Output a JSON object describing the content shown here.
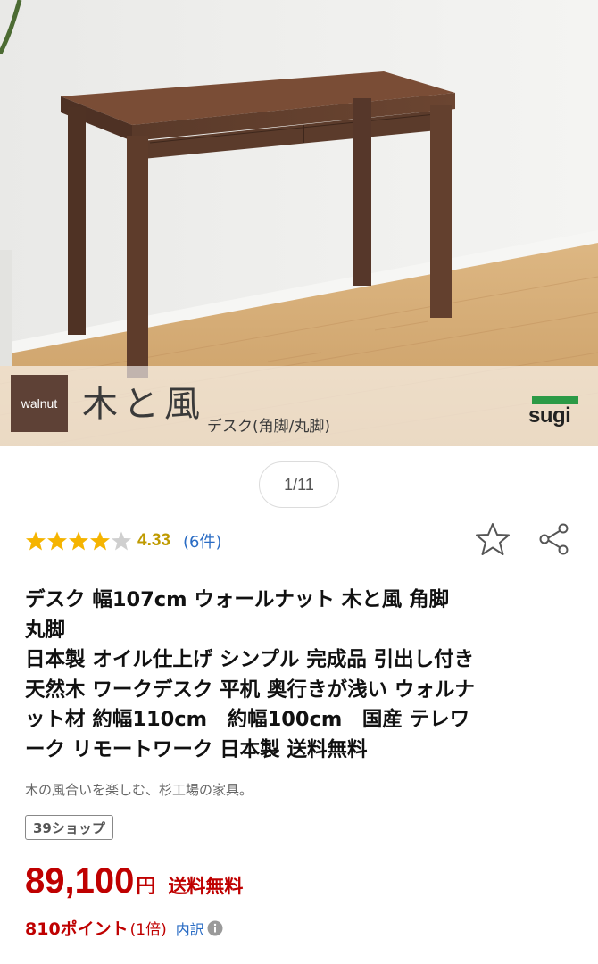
{
  "image": {
    "tag": "walnut",
    "brand_title": "木と風",
    "brand_subtitle": "デスク(角脚/丸脚)",
    "logo_text": "sugi"
  },
  "gallery": {
    "counter": "1/11"
  },
  "rating": {
    "value": "4.33",
    "count": "(6件)",
    "stars_filled": 4,
    "stars_total": 5,
    "star_color": "#f5b400",
    "star_empty_color": "#cfcfcf"
  },
  "actions": {
    "favorite_icon": "star-outline-icon",
    "share_icon": "share-icon"
  },
  "product": {
    "title_lines": [
      "デスク 幅107cm ウォールナット 木と風 角脚",
      "丸脚",
      "日本製 オイル仕上げ シンプル 完成品 引出し付き",
      "天然木 ワークデスク 平机 奥行きが浅い ウォルナ",
      "ット材 約幅110cm　約幅100cm　国産 テレワ",
      "ーク リモートワーク 日本製 送料無料"
    ],
    "catch_copy": "木の風合いを楽しむ、杉工場の家具。",
    "shop_tag": "39ショップ"
  },
  "price": {
    "amount": "89,100",
    "currency": "円",
    "shipping": "送料無料",
    "points": "810ポイント",
    "points_multiplier": "(1倍)",
    "breakdown_link": "内訳",
    "accent_color": "#bf0000"
  }
}
